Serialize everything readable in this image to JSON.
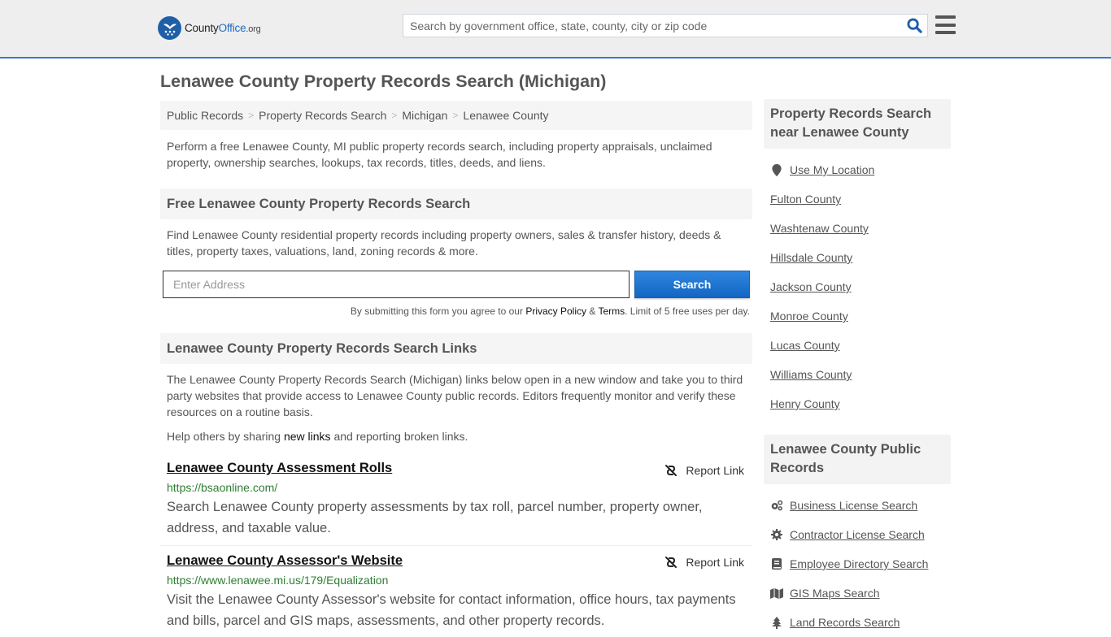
{
  "header": {
    "logo": {
      "county": "County",
      "office": "Office",
      "org": ".org"
    },
    "search_placeholder": "Search by government office, state, county, city or zip code",
    "search_icon": "search-icon",
    "menu_icon": "hamburger-menu-icon"
  },
  "page_title": "Lenawee County Property Records Search (Michigan)",
  "breadcrumb": [
    {
      "label": "Public Records"
    },
    {
      "label": "Property Records Search"
    },
    {
      "label": "Michigan"
    },
    {
      "label": "Lenawee County"
    }
  ],
  "breadcrumb_separator": ">",
  "intro": "Perform a free Lenawee County, MI public property records search, including property appraisals, unclaimed property, ownership searches, lookups, tax records, titles, deeds, and liens.",
  "free_search": {
    "heading": "Free Lenawee County Property Records Search",
    "description": "Find Lenawee County residential property records including property owners, sales & transfer history, deeds & titles, property taxes, valuations, land, zoning records & more.",
    "address_placeholder": "Enter Address",
    "button_label": "Search",
    "note_prefix": "By submitting this form you agree to our ",
    "privacy_label": "Privacy Policy",
    "note_amp": " & ",
    "terms_label": "Terms",
    "note_suffix": ". Limit of 5 free uses per day."
  },
  "links_section": {
    "heading": "Lenawee County Property Records Search Links",
    "description": "The Lenawee County Property Records Search (Michigan) links below open in a new window and take you to third party websites that provide access to Lenawee County public records. Editors frequently monitor and verify these resources on a routine basis.",
    "help_prefix": "Help others by sharing ",
    "help_link": "new links",
    "help_suffix": " and reporting broken links.",
    "report_label": "Report Link",
    "items": [
      {
        "title": "Lenawee County Assessment Rolls",
        "url": "https://bsaonline.com/",
        "description": "Search Lenawee County property assessments by tax roll, parcel number, property owner, address, and taxable value."
      },
      {
        "title": "Lenawee County Assessor's Website",
        "url": "https://www.lenawee.mi.us/179/Equalization",
        "description": "Visit the Lenawee County Assessor's website for contact information, office hours, tax payments and bills, parcel and GIS maps, assessments, and other property records."
      }
    ]
  },
  "sidebar": {
    "nearby": {
      "heading": "Property Records Search near Lenawee County",
      "use_location": "Use My Location",
      "counties": [
        "Fulton County",
        "Washtenaw County",
        "Hillsdale County",
        "Jackson County",
        "Monroe County",
        "Lucas County",
        "Williams County",
        "Henry County"
      ]
    },
    "public_records": {
      "heading": "Lenawee County Public Records",
      "items": [
        {
          "label": "Business License Search",
          "icon": "cogs-icon"
        },
        {
          "label": "Contractor License Search",
          "icon": "gear-icon"
        },
        {
          "label": "Employee Directory Search",
          "icon": "book-icon"
        },
        {
          "label": "GIS Maps Search",
          "icon": "map-icon"
        },
        {
          "label": "Land Records Search",
          "icon": "tree-icon"
        }
      ]
    }
  },
  "colors": {
    "brand_blue": "#1f6ac3",
    "header_bg": "#eeeeee",
    "header_border": "#3a7cc4",
    "button_blue": "#1a73d0",
    "url_green": "#2e7d32",
    "text_gray": "#555555"
  }
}
